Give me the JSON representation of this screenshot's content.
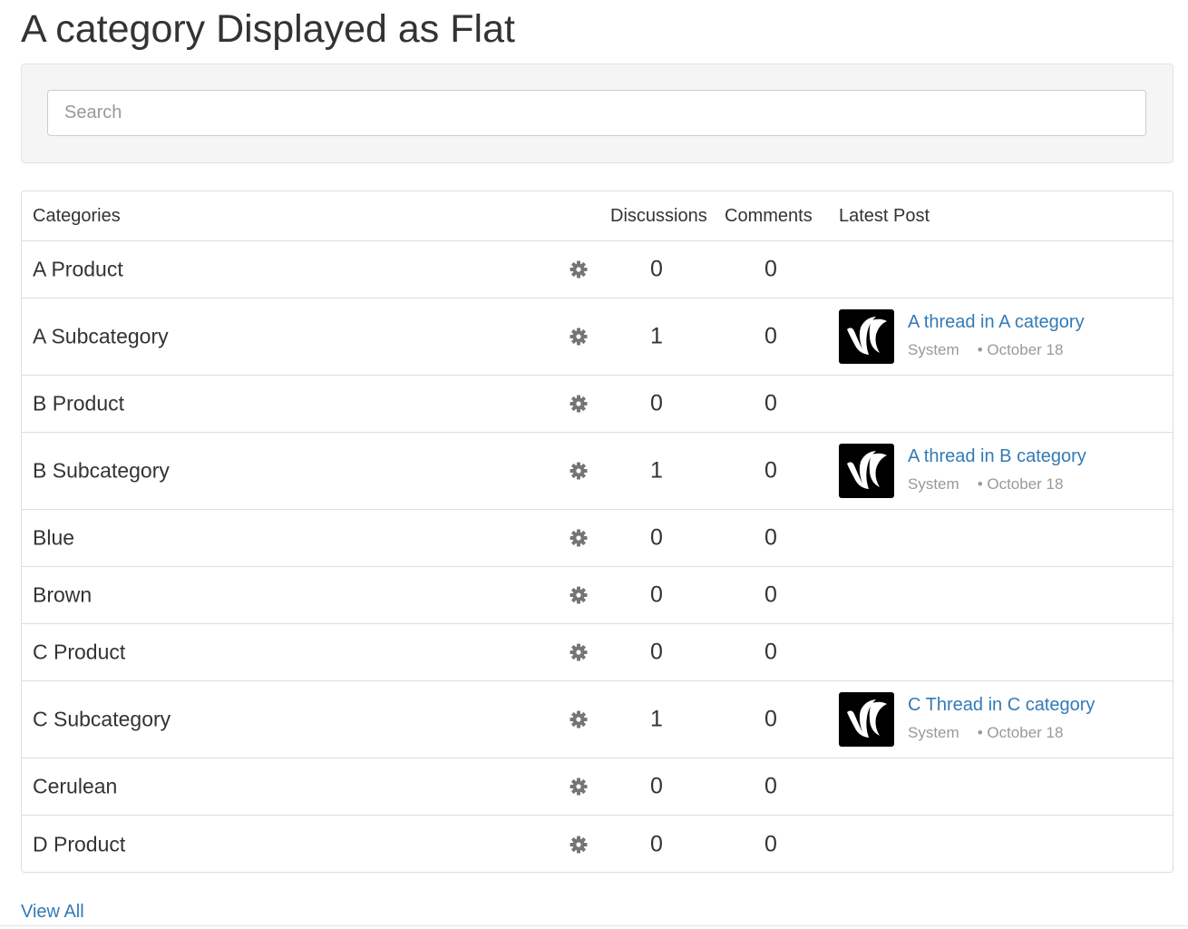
{
  "page": {
    "title": "A category Displayed as Flat"
  },
  "search": {
    "placeholder": "Search",
    "value": ""
  },
  "table": {
    "headers": {
      "categories": "Categories",
      "discussions": "Discussions",
      "comments": "Comments",
      "latest_post": "Latest Post"
    },
    "rows": [
      {
        "name": "A Product",
        "discussions": "0",
        "comments": "0",
        "latest": null
      },
      {
        "name": "A Subcategory",
        "discussions": "1",
        "comments": "0",
        "latest": {
          "title": "A thread in A category",
          "author": "System",
          "date": "• October 18"
        }
      },
      {
        "name": "B Product",
        "discussions": "0",
        "comments": "0",
        "latest": null
      },
      {
        "name": "B Subcategory",
        "discussions": "1",
        "comments": "0",
        "latest": {
          "title": "A thread in B category",
          "author": "System",
          "date": "• October 18"
        }
      },
      {
        "name": "Blue",
        "discussions": "0",
        "comments": "0",
        "latest": null
      },
      {
        "name": "Brown",
        "discussions": "0",
        "comments": "0",
        "latest": null
      },
      {
        "name": "C Product",
        "discussions": "0",
        "comments": "0",
        "latest": null
      },
      {
        "name": "C Subcategory",
        "discussions": "1",
        "comments": "0",
        "latest": {
          "title": "C Thread in C category",
          "author": "System",
          "date": "• October 18"
        }
      },
      {
        "name": "Cerulean",
        "discussions": "0",
        "comments": "0",
        "latest": null
      },
      {
        "name": "D Product",
        "discussions": "0",
        "comments": "0",
        "latest": null
      }
    ]
  },
  "footer": {
    "view_all": "View All"
  },
  "icons": {
    "row_options": "gear-icon",
    "avatar": "vanilla-logo-icon"
  },
  "colors": {
    "link": "#337ab7",
    "muted": "#999999",
    "well": "#f5f5f5",
    "border": "#dddddd"
  }
}
